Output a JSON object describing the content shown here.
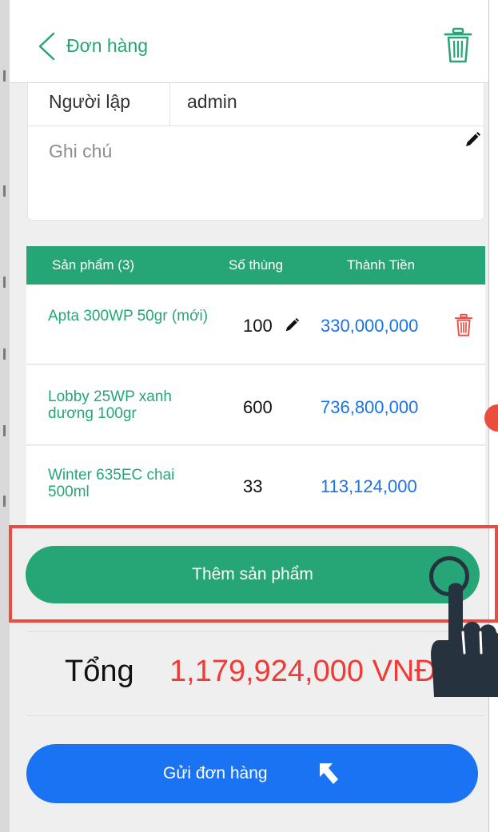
{
  "header": {
    "title": "Đơn hàng"
  },
  "order_info": {
    "creator_label": "Người lập",
    "creator_value": "admin",
    "note_placeholder": "Ghi chú"
  },
  "table": {
    "columns": [
      "Sản phẩm (3)",
      "Số thùng",
      "Thành Tiền"
    ],
    "rows": [
      {
        "name": "Apta 300WP 50gr (mới)",
        "qty": "100",
        "amount": "330,000,000"
      },
      {
        "name": "Lobby 25WP xanh dương 100gr",
        "qty": "600",
        "amount": "736,800,000"
      },
      {
        "name": "Winter 635EC chai 500ml",
        "qty": "33",
        "amount": "113,124,000"
      }
    ]
  },
  "actions": {
    "add_product_label": "Thêm sản phẩm",
    "send_order_label": "Gửi đơn hàng"
  },
  "total": {
    "label": "Tổng",
    "value": "1,179,924,000 VNĐ"
  },
  "colors": {
    "brand_green": "#26a676",
    "link_blue": "#1a73e8",
    "send_blue": "#1a73f2",
    "total_red": "#f03a35",
    "delete_red": "#e8524a",
    "highlight_red": "#ec4b44"
  },
  "icons": [
    "chevron-left-icon",
    "trash-icon",
    "pencil-icon",
    "arrow-up-left-icon",
    "pointing-hand-icon"
  ]
}
